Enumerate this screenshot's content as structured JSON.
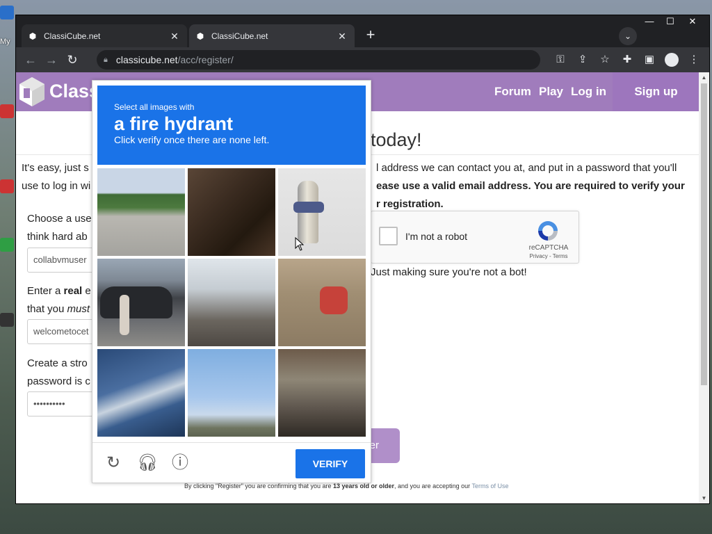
{
  "tabs": [
    {
      "label": "ClassiCube.net"
    },
    {
      "label": "ClassiCube.net"
    }
  ],
  "omnibox": {
    "domain": "classicube.net",
    "path": "/acc/register/"
  },
  "site": {
    "logo_text": "Class",
    "nav": {
      "forum": "Forum",
      "play": "Play",
      "login": "Log in",
      "signup": "Sign up"
    },
    "heading": "today!",
    "intro": {
      "a": "It's easy, just s",
      "b": "use to log in wi",
      "c": "l address we can contact you at, and put in a password that you'll",
      "d": "ease use a valid email address. You are required to verify your",
      "e": "r registration."
    },
    "fields": [
      {
        "label_l1": "Choose a use",
        "label_l2": "think hard ab",
        "value": "collabvmuser"
      },
      {
        "label_l1_pre": "Enter a ",
        "label_l1_bold": "real",
        "label_l1_post": " e",
        "label_l2_pre": "that you ",
        "label_l2_em": "must",
        "value": "welcometocet"
      },
      {
        "label_l1": "Create a stro",
        "label_l2": "password is c",
        "value": "••••••••••"
      }
    ],
    "recaptcha": {
      "label": "I'm not a robot",
      "brand": "reCAPTCHA",
      "links": "Privacy - Terms"
    },
    "bot_note": "Just making sure you're not a bot!",
    "register_label": "er",
    "footer": {
      "pre": "By clicking \"Register\" you are confirming that you are ",
      "bold": "13 years old or older",
      "mid": ", and you are accepting our ",
      "link": "Terms of Use"
    }
  },
  "challenge": {
    "pre": "Select all images with",
    "target": "a fire hydrant",
    "post": "Click verify once there are none left.",
    "verify_label": "VERIFY",
    "tiles": [
      "parking-lot",
      "motorcycle",
      "fire-hydrant",
      "parked-cars",
      "street-signal",
      "scooter",
      "car-wiper",
      "crane-sky",
      "bicycles"
    ]
  },
  "colors": {
    "brand": "#a07cbc",
    "accent": "#1a73e8"
  }
}
